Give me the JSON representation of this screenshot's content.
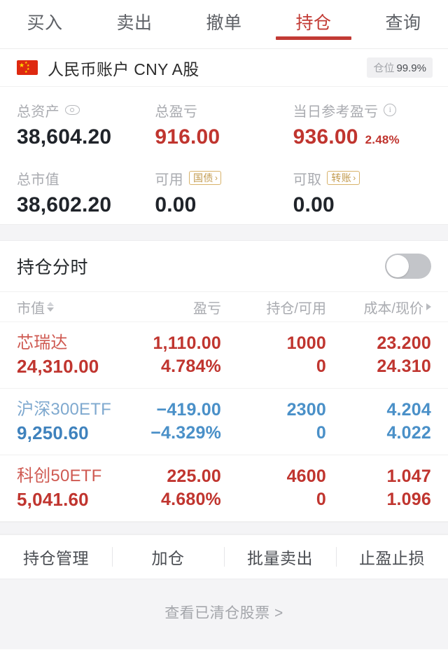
{
  "tabs": [
    {
      "label": "买入",
      "active": false
    },
    {
      "label": "卖出",
      "active": false
    },
    {
      "label": "撤单",
      "active": false
    },
    {
      "label": "持仓",
      "active": true
    },
    {
      "label": "查询",
      "active": false
    }
  ],
  "account": {
    "flag_icon": "china-flag-icon",
    "name": "人民币账户 CNY A股",
    "position_chip_label": "仓位",
    "position_chip_value": "99.9%"
  },
  "summary": {
    "total_assets": {
      "label": "总资产",
      "icon": "eye-icon",
      "value": "38,604.20"
    },
    "total_pl": {
      "label": "总盈亏",
      "value": "916.00"
    },
    "today_pl": {
      "label": "当日参考盈亏",
      "icon": "info-icon",
      "value": "936.00",
      "percent": "2.48%"
    },
    "market_value": {
      "label": "总市值",
      "value": "38,602.20"
    },
    "available": {
      "label": "可用",
      "badge": "国债",
      "badge_chevron": "›",
      "value": "0.00"
    },
    "withdrawable": {
      "label": "可取",
      "badge": "转账",
      "badge_chevron": "›",
      "value": "0.00"
    }
  },
  "intraday": {
    "title": "持仓分时",
    "toggle_on": false
  },
  "table": {
    "headers": {
      "market_value": "市值",
      "pl": "盈亏",
      "qty": "持仓/可用",
      "cost": "成本/现价"
    },
    "rows": [
      {
        "name": "芯瑞达",
        "market_value": "24,310.00",
        "pl_amount": "1,110.00",
        "pl_percent": "4.784%",
        "qty_hold": "1000",
        "qty_avail": "0",
        "cost": "23.200",
        "price": "24.310",
        "direction": "up"
      },
      {
        "name": "沪深300ETF",
        "market_value": "9,250.60",
        "pl_amount": "−419.00",
        "pl_percent": "−4.329%",
        "qty_hold": "2300",
        "qty_avail": "0",
        "cost": "4.204",
        "price": "4.022",
        "direction": "down"
      },
      {
        "name": "科创50ETF",
        "market_value": "5,041.60",
        "pl_amount": "225.00",
        "pl_percent": "4.680%",
        "qty_hold": "4600",
        "qty_avail": "0",
        "cost": "1.047",
        "price": "1.096",
        "direction": "up"
      }
    ]
  },
  "actions": [
    {
      "label": "持仓管理"
    },
    {
      "label": "加仓"
    },
    {
      "label": "批量卖出"
    },
    {
      "label": "止盈止损"
    }
  ],
  "footer": {
    "link": "查看已清仓股票 >"
  },
  "colors": {
    "up_red": "#c0352f",
    "down_blue": "#4a90c8",
    "accent": "#c23b35",
    "gold": "#c29a4e",
    "muted": "#a9abb0"
  }
}
